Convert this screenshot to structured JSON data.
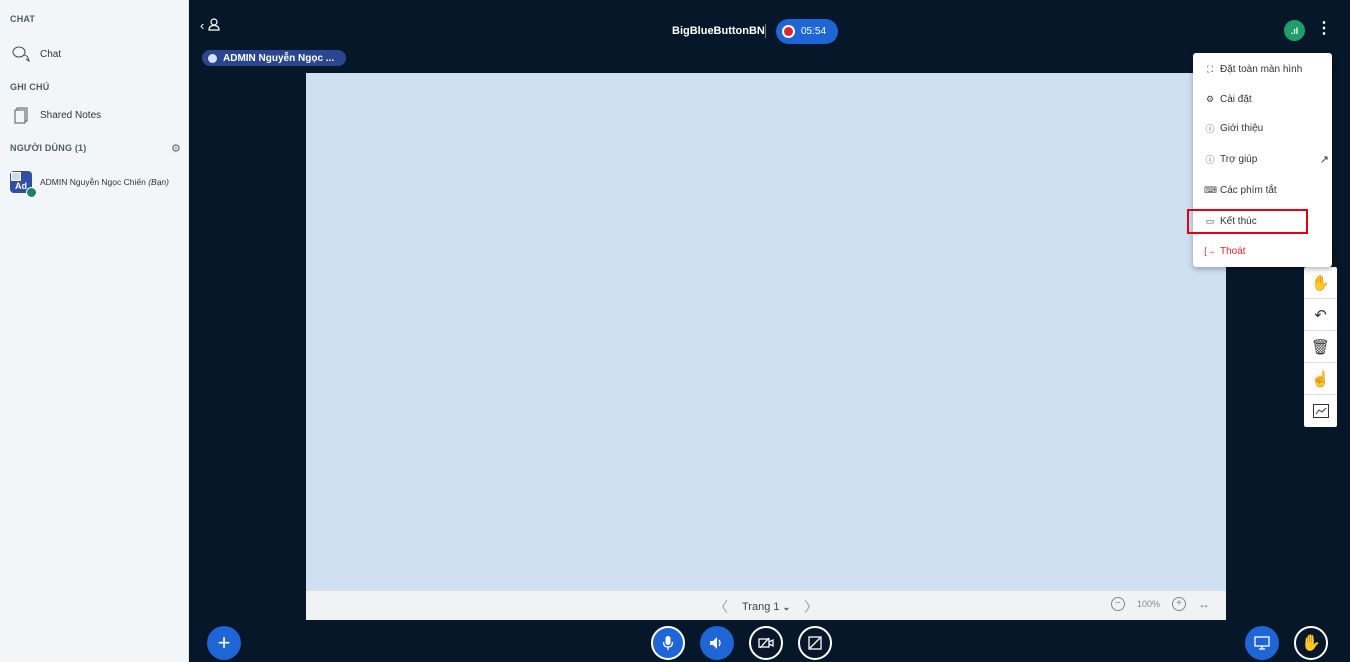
{
  "sidebar": {
    "chat_section": "CHAT",
    "chat_item": "Chat",
    "notes_section": "GHI CHÚ",
    "notes_item": "Shared Notes",
    "users_section": "NGƯỜI DÙNG (1)",
    "user": {
      "avatar_initials": "Ad",
      "name": "ADMIN Nguyễn Ngọc Chiến",
      "you_tag": "(Bạn)"
    }
  },
  "header": {
    "talker": "ADMIN Nguyễn Ngọc ...",
    "meeting_title": "BigBlueButtonBN",
    "record_time": "05:54",
    "connection_icon": "signal-bars-icon"
  },
  "menu": {
    "items": [
      {
        "label": "Đặt toàn màn hình",
        "icon": "fullscreen-icon"
      },
      {
        "label": "Cài đặt",
        "icon": "settings-icon"
      },
      {
        "label": "Giới thiệu",
        "icon": "info-icon"
      },
      {
        "label": "Trợ giúp",
        "icon": "help-icon",
        "external_icon": "external-link-icon"
      },
      {
        "label": "Các phím tắt",
        "icon": "keyboard-icon"
      },
      {
        "label": "Kết thúc",
        "icon": "end-meeting-icon",
        "highlighted": true
      },
      {
        "label": "Thoát",
        "icon": "logout-icon",
        "color": "#e0242d"
      }
    ]
  },
  "tools": [
    "hand-pan-icon",
    "undo-icon",
    "trash-icon",
    "pointer-hand-icon",
    "chart-icon"
  ],
  "slide": {
    "page_label": "Trang 1",
    "zoom": "100%"
  },
  "bottom_bar": {
    "actions_icon": "plus-icon",
    "mic_icon": "microphone-icon",
    "audio_icon": "speaker-icon",
    "video_icon": "camera-off-icon",
    "screenshare_icon": "screenshare-off-icon",
    "presentation_icon": "presentation-icon",
    "raise_hand_icon": "raise-hand-icon"
  },
  "colors": {
    "accent": "#1e66d6",
    "dark_bg": "#06172a",
    "slide_bg": "#cfe0f1",
    "danger": "#e0242d",
    "highlight_box": "#e60012"
  }
}
